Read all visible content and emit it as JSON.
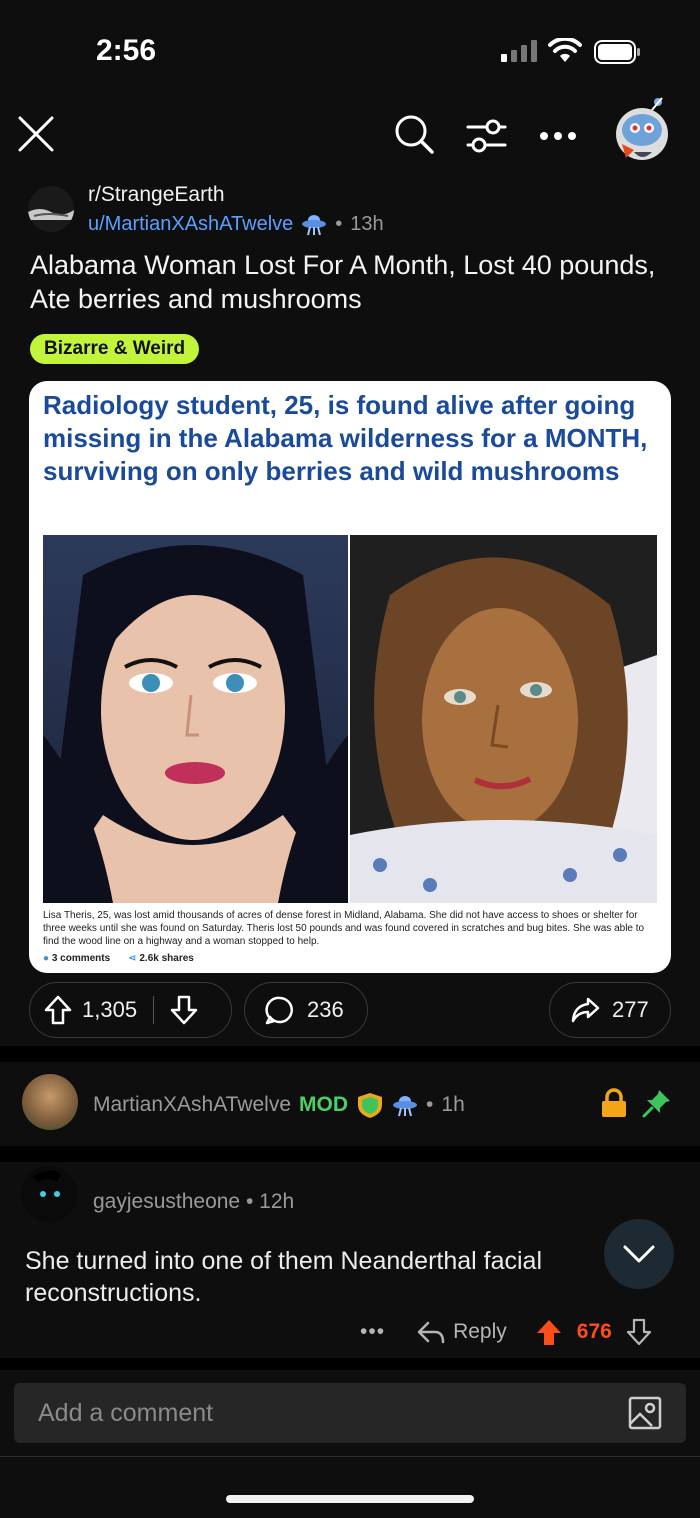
{
  "status_bar": {
    "time": "2:56"
  },
  "post": {
    "subreddit": "r/StrangeEarth",
    "author": "u/MartianXAshATwelve",
    "age": "13h",
    "title": "Alabama Woman Lost For A Month, Lost 40 pounds, Ate berries and mushrooms",
    "flair": "Bizarre & Weird",
    "image": {
      "headline": "Radiology student, 25, is found alive after going missing in the Alabama wilderness for a MONTH, surviving on only berries and wild mushrooms",
      "caption": "Lisa Theris, 25, was lost amid thousands of acres of dense forest in Midland, Alabama. She did not have access to shoes or shelter for three weeks until she was found on Saturday. Theris lost 50 pounds and was found covered in scratches and bug bites. She was able to find the wood line on a highway and a woman stopped to help.",
      "comments_meta": "3 comments",
      "shares_meta": "2.6k shares"
    },
    "upvotes": "1,305",
    "comments_count": "236",
    "shares": "277"
  },
  "mod_comment": {
    "username": "MartianXAshATwelve",
    "badge": "MOD",
    "age": "1h"
  },
  "comment": {
    "username": "gayjesustheone",
    "age": "12h",
    "body": "She turned into one of them Neanderthal facial reconstructions.",
    "more": "•••",
    "reply_label": "Reply",
    "score": "676"
  },
  "compose": {
    "placeholder": "Add a comment"
  },
  "colors": {
    "accent_blue": "#5aa0ff",
    "flair_bg": "#c3f43c",
    "mod_green": "#4bd163",
    "upvote_orange": "#ff4d1a"
  }
}
